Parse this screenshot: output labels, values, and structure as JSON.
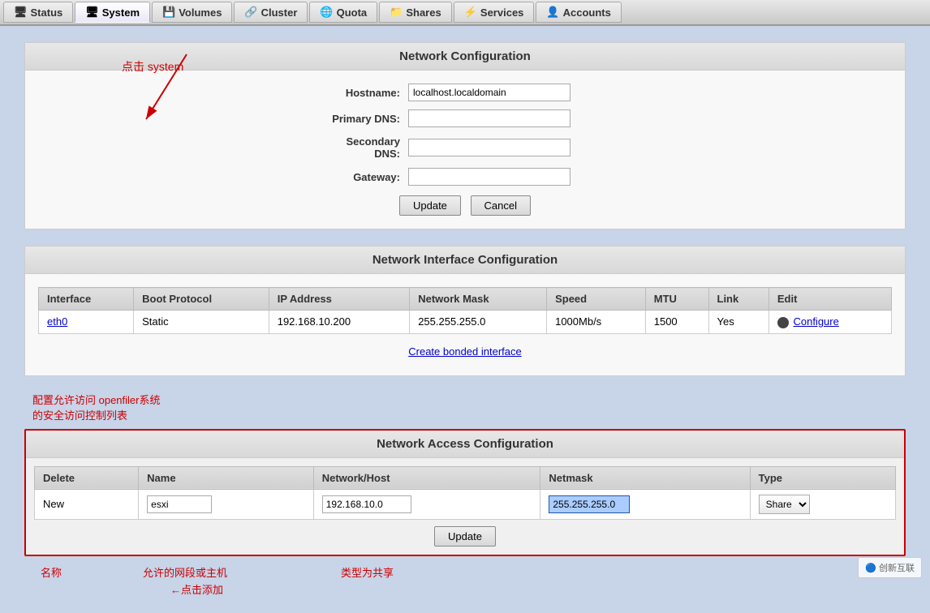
{
  "navbar": {
    "tabs": [
      {
        "label": "Status",
        "icon": "status-icon",
        "active": false
      },
      {
        "label": "System",
        "icon": "system-icon",
        "active": true
      },
      {
        "label": "Volumes",
        "icon": "volumes-icon",
        "active": false
      },
      {
        "label": "Cluster",
        "icon": "cluster-icon",
        "active": false
      },
      {
        "label": "Quota",
        "icon": "quota-icon",
        "active": false
      },
      {
        "label": "Shares",
        "icon": "shares-icon",
        "active": false
      },
      {
        "label": "Services",
        "icon": "services-icon",
        "active": false
      },
      {
        "label": "Accounts",
        "icon": "accounts-icon",
        "active": false
      }
    ]
  },
  "network_config": {
    "title": "Network Configuration",
    "fields": [
      {
        "label": "Hostname:",
        "value": "localhost.localdomain",
        "id": "hostname"
      },
      {
        "label": "Primary DNS:",
        "value": "",
        "id": "primary_dns"
      },
      {
        "label": "Secondary DNS:",
        "value": "",
        "id": "secondary_dns"
      },
      {
        "label": "Gateway:",
        "value": "",
        "id": "gateway"
      }
    ],
    "update_btn": "Update",
    "cancel_btn": "Cancel"
  },
  "network_interface": {
    "title": "Network Interface Configuration",
    "columns": [
      "Interface",
      "Boot Protocol",
      "IP Address",
      "Network Mask",
      "Speed",
      "MTU",
      "Link",
      "Edit"
    ],
    "rows": [
      {
        "interface": "eth0",
        "boot_protocol": "Static",
        "ip_address": "192.168.10.200",
        "network_mask": "255.255.255.0",
        "speed": "1000Mb/s",
        "mtu": "1500",
        "link": "Yes",
        "edit": "Configure"
      }
    ],
    "create_bonded": "Create bonded interface"
  },
  "network_access": {
    "title": "Network Access Configuration",
    "columns": [
      "Delete",
      "Name",
      "Network/Host",
      "Netmask",
      "Type"
    ],
    "rows": [
      {
        "delete_label": "New",
        "name": "esxi",
        "network_host": "192.168.10.0",
        "netmask": "255.255.255.0",
        "type": "Share"
      }
    ],
    "update_btn": "Update"
  },
  "annotations": {
    "click_system": "点击 system",
    "config_acl": "配置允许访问 openfiler系统\n的安全访问控制列表",
    "name_label": "名称",
    "network_label": "允许的网段或主机",
    "type_label": "类型为共享",
    "add_label": "点击添加"
  },
  "watermark": "创新互联"
}
